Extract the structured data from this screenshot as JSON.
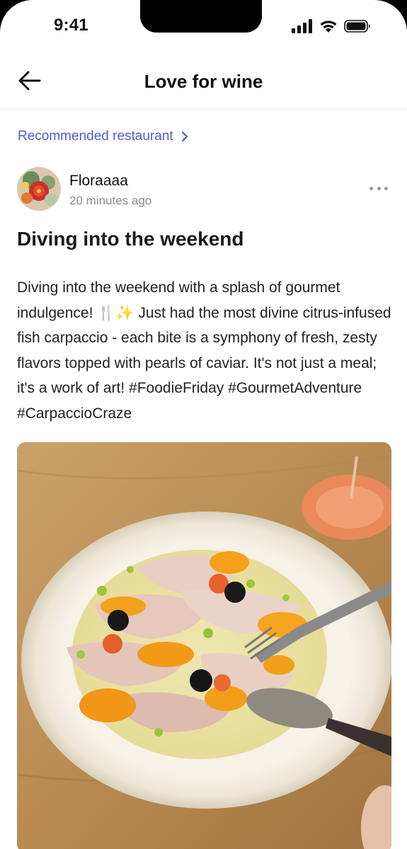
{
  "status_bar": {
    "time": "9:41"
  },
  "header": {
    "title": "Love for wine"
  },
  "recommended": {
    "label": "Recommended restaurant"
  },
  "author": {
    "name": "Floraaaa",
    "time": "20 minutes ago"
  },
  "post": {
    "title": "Diving into the weekend",
    "body": "Diving into the weekend with a splash of gourmet indulgence! 🍴✨ Just had the most divine citrus-infused fish carpaccio - each bite is a symphony of fresh, zesty flavors topped with pearls of caviar. It's not just a meal; it's a work of art! #FoodieFriday #GourmetAdventure #CarpaccioCraze"
  },
  "colors": {
    "accent": "#4a5fd0",
    "meta": "#8c8c8c",
    "text": "#1a1a1a"
  },
  "icons": [
    "signal-icon",
    "wifi-icon",
    "battery-icon",
    "arrow-left-icon",
    "chevron-right-icon",
    "more-horizontal-icon"
  ]
}
